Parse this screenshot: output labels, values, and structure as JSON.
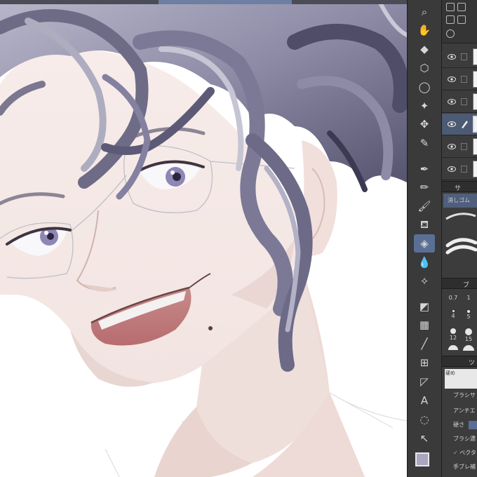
{
  "app": {
    "accent_color": "#5a6f96",
    "canvas_bg": "#ffffff"
  },
  "toolbar": {
    "tools": [
      {
        "name": "zoom-icon",
        "glyph": "⌕"
      },
      {
        "name": "hand-icon",
        "glyph": "✋"
      },
      {
        "name": "eraser-tool-icon",
        "glyph": "◆"
      },
      {
        "name": "object-icon",
        "glyph": "⬡"
      },
      {
        "name": "lasso-icon",
        "glyph": "◯"
      },
      {
        "name": "magic-wand-icon",
        "glyph": "✦"
      },
      {
        "name": "move-icon",
        "glyph": "✥"
      },
      {
        "name": "eyedropper-icon",
        "glyph": "✎"
      },
      {
        "name": "pen-icon",
        "glyph": "✒"
      },
      {
        "name": "pencil-icon",
        "glyph": "✏"
      },
      {
        "name": "brush-icon",
        "glyph": "🖌"
      },
      {
        "name": "airbrush-icon",
        "glyph": "⛾"
      },
      {
        "name": "eraser-icon",
        "glyph": "◈"
      },
      {
        "name": "blend-icon",
        "glyph": "💧"
      },
      {
        "name": "decoration-icon",
        "glyph": "✧"
      },
      {
        "name": "fill-icon",
        "glyph": "◩"
      },
      {
        "name": "gradient-icon",
        "glyph": "▦"
      },
      {
        "name": "figure-icon",
        "glyph": "╱"
      },
      {
        "name": "frame-icon",
        "glyph": "⊞"
      },
      {
        "name": "ruler-icon",
        "glyph": "◸"
      },
      {
        "name": "text-icon",
        "glyph": "A"
      },
      {
        "name": "balloon-icon",
        "glyph": "◌"
      },
      {
        "name": "correct-line-icon",
        "glyph": "↖"
      }
    ]
  },
  "panel": {
    "subtool_tab": "サ",
    "subtool_selected": "消しゴム",
    "brush_size_tab": "ブ",
    "brush_sizes": [
      "0.7",
      "1",
      "",
      "4",
      "5",
      "",
      "12",
      "15",
      ""
    ],
    "tool_property_tab": "ツ",
    "eraser_label": "硬め",
    "properties": [
      "ブラシサ",
      "アンチエ",
      "硬さ",
      "ブラシ濃",
      "ベクタ",
      "手ブレ補"
    ]
  }
}
